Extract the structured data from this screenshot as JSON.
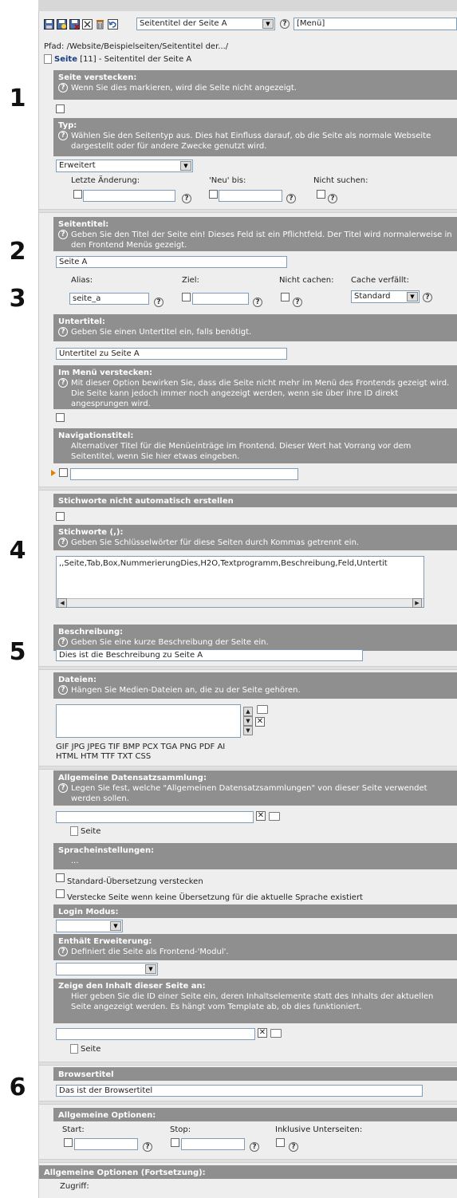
{
  "toolbar": {
    "page_select": "Seitentitel der Seite A",
    "menu_select": "[Menü]"
  },
  "breadcrumb": {
    "path": "Pfad: /Website/Beispielseiten/Seitentitel der.../",
    "record_type": "Seite",
    "record_id": "[11]",
    "record_title": "- Seitentitel der Seite A"
  },
  "markers": [
    "1",
    "2",
    "3",
    "4",
    "5",
    "6"
  ],
  "hide_page": {
    "title": "Seite verstecken:",
    "desc": "Wenn Sie dies markieren, wird die Seite nicht angezeigt."
  },
  "type": {
    "title": "Typ:",
    "desc": "Wählen Sie den Seitentyp aus. Dies hat Einfluss darauf, ob die Seite als normale Webseite dargestellt oder für andere Zwecke genutzt wird.",
    "value": "Erweitert",
    "last_change_label": "Letzte Änderung:",
    "new_until_label": "'Neu' bis:",
    "no_search_label": "Nicht suchen:"
  },
  "page_title": {
    "title": "Seitentitel:",
    "desc": "Geben Sie den Titel der Seite ein! Dieses Feld ist ein Pflichtfeld. Der Titel wird normalerweise in den Frontend Menüs gezeigt.",
    "value": "Seite A",
    "alias_label": "Alias:",
    "alias_value": "seite_a",
    "target_label": "Ziel:",
    "no_cache_label": "Nicht cachen:",
    "cache_expires_label": "Cache verfällt:",
    "cache_expires_value": "Standard"
  },
  "subtitle": {
    "title": "Untertitel:",
    "desc": "Geben Sie einen Untertitel ein, falls benötigt.",
    "value": "Untertitel zu Seite A"
  },
  "hide_in_menu": {
    "title": "Im Menü verstecken:",
    "desc": "Mit dieser Option bewirken Sie, dass die Seite nicht mehr im Menü des Frontends gezeigt wird. Die Seite kann jedoch immer noch angezeigt werden, wenn sie über ihre ID direkt angesprungen wird."
  },
  "nav_title": {
    "title": "Navigationstitel:",
    "desc": "Alternativer Titel für die Menüeinträge im Frontend. Dieser Wert hat Vorrang vor dem Seitentitel, wenn Sie hier etwas eingeben."
  },
  "no_auto_keywords": {
    "title": "Stichworte nicht automatisch erstellen"
  },
  "keywords": {
    "title": "Stichworte (,):",
    "desc": "Geben Sie Schlüsselwörter für diese Seiten durch Kommas getrennt ein.",
    "value": ",,Seite,Tab,Box,NummerierungDies,H2O,Textprogramm,Beschreibung,Feld,Untertit"
  },
  "description": {
    "title": "Beschreibung:",
    "desc": "Geben Sie eine kurze Beschreibung der Seite ein.",
    "value": "Dies ist die Beschreibung zu Seite A"
  },
  "files": {
    "title": "Dateien:",
    "desc": "Hängen Sie Medien-Dateien an, die zu der Seite gehören.",
    "types_line1": "GIF JPG JPEG TIF BMP PCX TGA PNG PDF AI",
    "types_line2": "HTML HTM TTF TXT CSS"
  },
  "record_collection": {
    "title": "Allgemeine Datensatzsammlung:",
    "desc": "Legen Sie fest, welche \"Allgemeinen Datensatzsammlungen\" von dieser Seite verwendet werden sollen.",
    "item_label": "Seite"
  },
  "language": {
    "title": "Spracheinstellungen:",
    "desc": "...",
    "hide_default": "Standard-Übersetzung verstecken",
    "hide_no_translation": "Verstecke Seite wenn keine Übersetzung für die aktuelle Sprache existiert"
  },
  "login_mode": {
    "title": "Login Modus:"
  },
  "contains_extension": {
    "title": "Enthält Erweiterung:",
    "desc": "Definiert die Seite als Frontend-'Modul'."
  },
  "show_content": {
    "title": "Zeige den Inhalt dieser Seite an:",
    "desc": "Hier geben Sie die ID einer Seite ein, deren Inhaltselemente statt des Inhalts der aktuellen Seite angezeigt werden. Es hängt vom Template ab, ob dies funktioniert.",
    "item_label": "Seite"
  },
  "browser_title": {
    "title": "Browsertitel",
    "value": "Das ist der Browsertitel"
  },
  "general_options": {
    "title": "Allgemeine Optionen:",
    "start_label": "Start:",
    "stop_label": "Stop:",
    "include_subpages_label": "Inklusive Unterseiten:"
  },
  "general_options_cont": {
    "title": "Allgemeine Optionen (Fortsetzung):",
    "access_label": "Zugriff:"
  }
}
